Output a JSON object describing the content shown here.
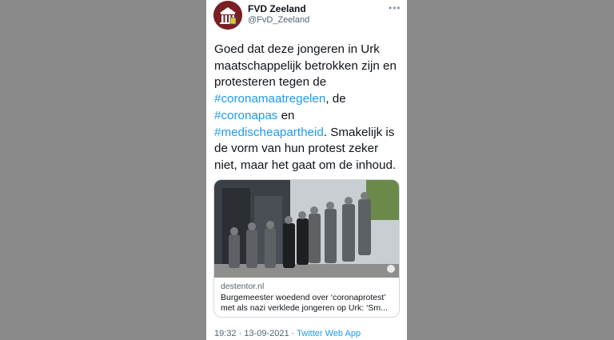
{
  "tweet": {
    "display_name": "FVD Zeeland",
    "handle": "@FvD_Zeeland",
    "more_icon": "more-horizontal-icon",
    "text": {
      "line1": "Goed dat deze jongeren in Urk",
      "line2": "maatschappelijk betrokken zijn en",
      "line3": "protesteren tegen de",
      "hashtag1": "#coronamaatregelen",
      "after_hashtag1": ", de",
      "hashtag2": "#coronapas",
      "after_hashtag2": " en",
      "hashtag3": "#medischeapartheid",
      "after_hashtag3": ". Smakelijk is",
      "line7": "de vorm van hun protest zeker",
      "line8": "niet, maar het gaat om de inhoud."
    },
    "link_card": {
      "domain": "destentor.nl",
      "title": "Burgemeester woedend over ‘coronaprotest’ met als nazi verklede jongeren op Urk: ‘Sm..."
    },
    "time": "19:32",
    "separator1": " · ",
    "date": "13-09-2021",
    "separator2": " · ",
    "source": "Twitter Web App"
  },
  "colors": {
    "background": "#8a8a8a",
    "hashtag": "#1d9bf0",
    "text": "#0f1419",
    "muted": "#536471",
    "avatar": "#7a1f24"
  }
}
